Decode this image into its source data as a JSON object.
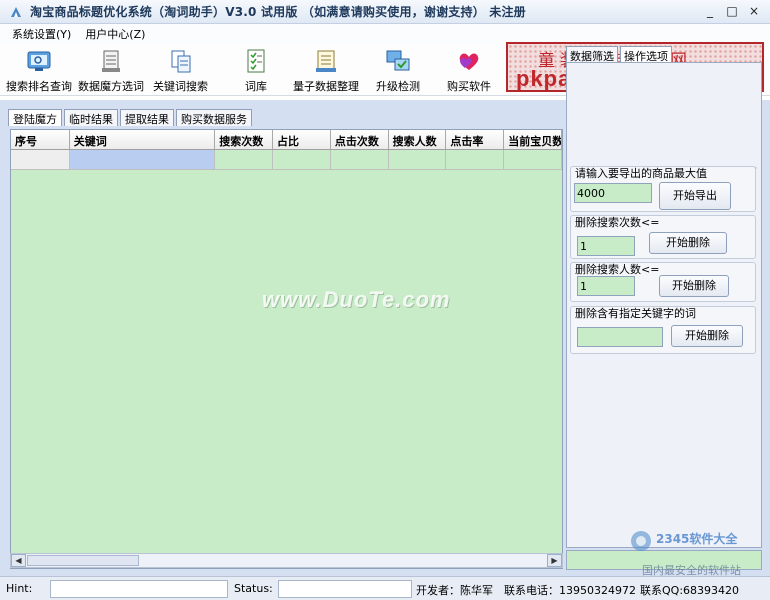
{
  "window": {
    "title": "淘宝商品标题优化系统（淘词助手）V3.0 试用版 （如满意请购买使用，谢谢支持）  未注册",
    "minimize_glyph": "_",
    "maximize_glyph": "□",
    "close_glyph": "×"
  },
  "menu": {
    "items": [
      "系统设置(Y)",
      "用户中心(Z)"
    ]
  },
  "toolbar": {
    "items": [
      {
        "label": "搜索排名查询",
        "icon": "search-rank-icon"
      },
      {
        "label": "数据魔方选词",
        "icon": "data-cube-icon"
      },
      {
        "label": "关键词搜索",
        "icon": "keyword-doc-icon"
      },
      {
        "label": "词库",
        "icon": "word-library-icon"
      },
      {
        "label": "量子数据整理",
        "icon": "quantum-data-icon"
      },
      {
        "label": "升级检测",
        "icon": "upgrade-check-icon"
      },
      {
        "label": "购买软件",
        "icon": "buy-hearts-icon"
      }
    ]
  },
  "banner": {
    "line1": "童装童鞋导购网",
    "line2": "pkpaipai.com"
  },
  "main_tabs": [
    "登陆魔方",
    "临时结果",
    "提取结果",
    "购买数据服务"
  ],
  "grid": {
    "columns": [
      "序号",
      "关键词",
      "搜索次数",
      "占比",
      "点击次数",
      "搜索人数",
      "点击率",
      "当前宝贝数"
    ]
  },
  "right_tabs": [
    "数据筛选",
    "操作选项"
  ],
  "panel": {
    "export": {
      "label": "请输入要导出的商品最大值",
      "value": "4000",
      "button": "开始导出"
    },
    "del_search": {
      "label": "删除搜索次数<=",
      "value": "1",
      "button": "开始删除"
    },
    "del_people": {
      "label": "删除搜索人数<=",
      "value": "1",
      "button": "开始删除"
    },
    "del_keyword": {
      "label": "删除含有指定关键字的词",
      "value": "",
      "button": "开始删除"
    }
  },
  "status": {
    "hint_label": "Hint:",
    "status_label": "Status:",
    "developer": "开发者：陈华军",
    "phone": "联系电话：13950324972",
    "qq": "联系QQ:68393420"
  },
  "watermark": {
    "main": "www.DuoTe.com",
    "corner1": "2345软件大全",
    "corner2": "国内最安全的软件站"
  }
}
